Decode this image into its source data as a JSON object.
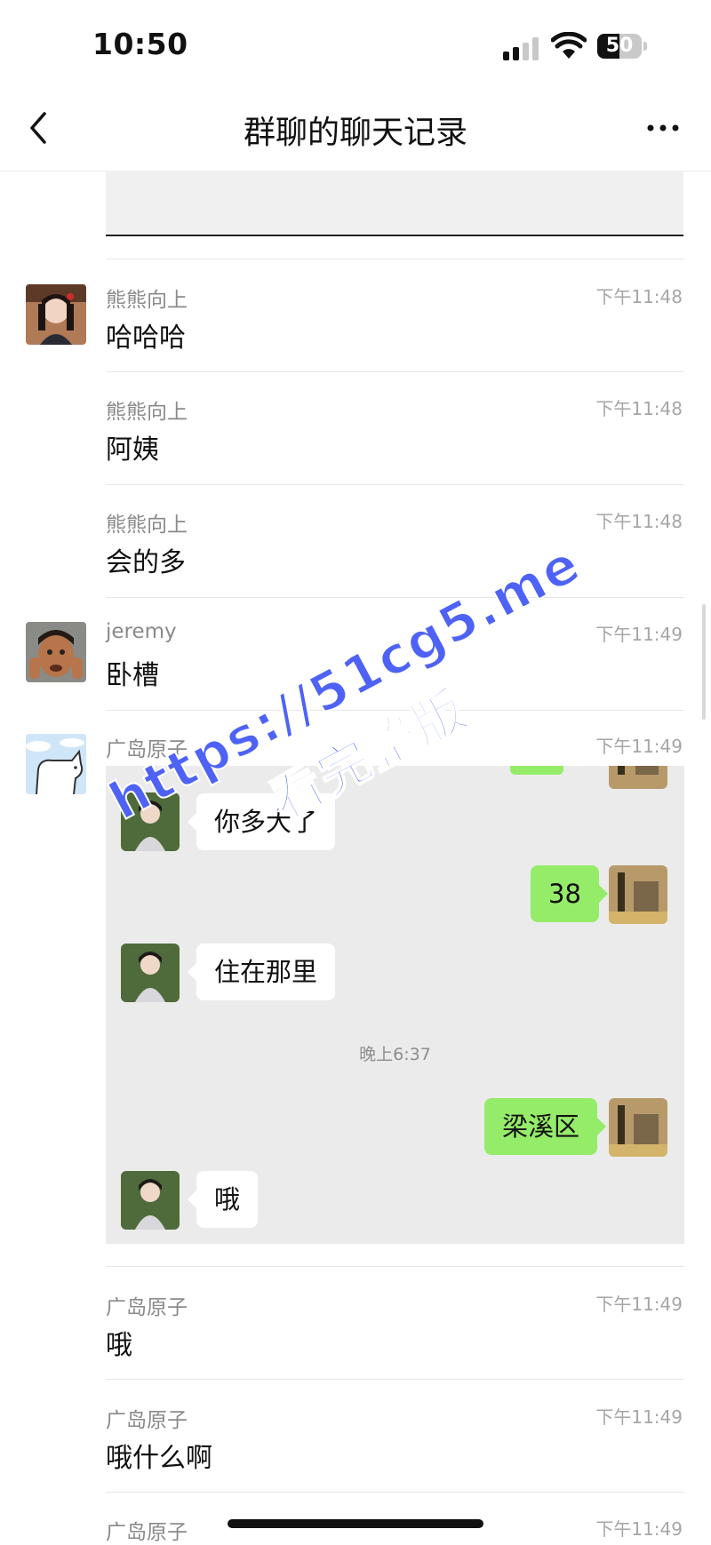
{
  "status_bar": {
    "time": "10:50",
    "battery": "50",
    "battery_level": 0.5
  },
  "nav": {
    "title": "群聊的聊天记录"
  },
  "messages": [
    {
      "name": "熊熊向上",
      "time": "下午11:48",
      "text": "哈哈哈"
    },
    {
      "name": "熊熊向上",
      "time": "下午11:48",
      "text": "阿姨"
    },
    {
      "name": "熊熊向上",
      "time": "下午11:48",
      "text": "会的多"
    },
    {
      "name": "jeremy",
      "time": "下午11:49",
      "text": "卧槽"
    },
    {
      "name": "广岛原子",
      "time": "下午11:49"
    },
    {
      "name": "广岛原子",
      "time": "下午11:49",
      "text": "哦"
    },
    {
      "name": "广岛原子",
      "time": "下午11:49",
      "text": "哦什么啊"
    },
    {
      "name": "广岛原子",
      "time": "下午11:49"
    }
  ],
  "forwarded": {
    "bubbles": [
      "你多大了",
      "38",
      "住在那里",
      "梁溪区",
      "哦"
    ],
    "time": "晚上6:37"
  },
  "watermark": {
    "line1": "https://51cg5.me",
    "line2": "看完整版"
  }
}
